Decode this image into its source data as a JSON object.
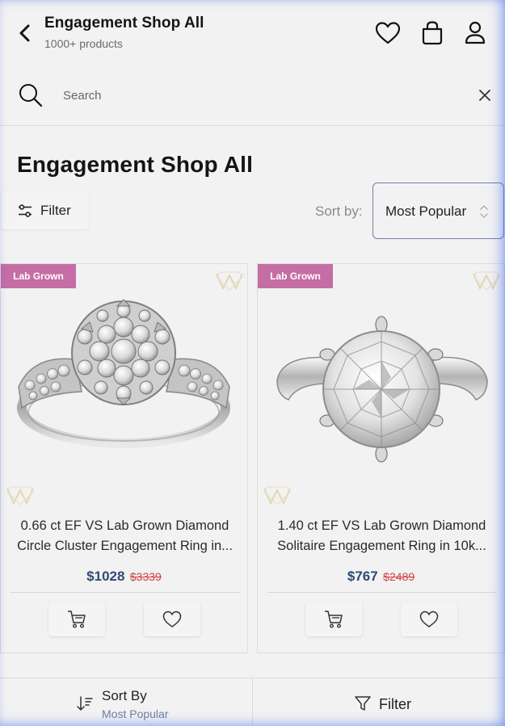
{
  "header": {
    "title": "Engagement Shop All",
    "subtitle": "1000+ products"
  },
  "search": {
    "placeholder": "Search"
  },
  "page": {
    "title": "Engagement Shop All"
  },
  "controls": {
    "filter_label": "Filter",
    "sort_label": "Sort by:",
    "sort_value": "Most Popular"
  },
  "products": [
    {
      "badge": "Lab Grown",
      "title_line1": "0.66 ct EF VS Lab Grown Diamond",
      "title_line2": "Circle Cluster Engagement Ring in...",
      "price": "$1028",
      "old_price": "$3339"
    },
    {
      "badge": "Lab Grown",
      "title_line1": "1.40 ct EF VS Lab Grown Diamond",
      "title_line2": "Solitaire Engagement Ring in 10k...",
      "price": "$767",
      "old_price": "$2489"
    }
  ],
  "bottom_bar": {
    "sort_label": "Sort By",
    "sort_value": "Most Popular",
    "filter_label": "Filter"
  },
  "colors": {
    "badge": "#c56da5",
    "price": "#2f4a73",
    "old_price": "#d24141",
    "sort_border": "#6f7fa8"
  }
}
